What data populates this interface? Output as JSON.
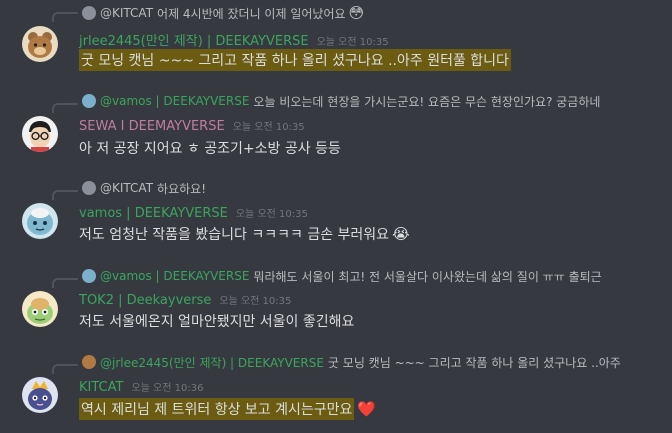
{
  "messages": [
    {
      "reply": {
        "name": "@KITCAT",
        "text": "어제 4시반에 잤더니 이제 일어났어요",
        "emoji": "😳"
      },
      "author": "jrlee2445(만인 제작) | DEEKAYVERSE",
      "author_color": "#3ba55d",
      "time": "오늘 오전 10:35",
      "text": "굿 모닝 캣님 ~~~ 그리고 작품 하나 올리 셨구나요 ..아주 원터풀 합니다",
      "avatar": "bear-avatar"
    },
    {
      "reply": {
        "name": "@vamos | DEEKAYVERSE",
        "text": "오늘 비오는데 현장을 가시는군요! 요즘은 무슨 현장인가요? 궁금하네"
      },
      "author": "SEWA I DEEMAYVERSE",
      "author_color": "#c27c9e",
      "time": "오늘 오전 10:35",
      "text": "아 저 공장 지어요 ㅎ 공조기+소방 공사 등등",
      "avatar": "glasses-avatar"
    },
    {
      "reply": {
        "name": "@KITCAT",
        "text": "하요하요!"
      },
      "author": "vamos | DEEKAYVERSE",
      "author_color": "#3ba55d",
      "time": "오늘 오전 10:35",
      "text": "저도 엄청난 작품을 봤습니다 ㅋㅋㅋㅋ 금손 부러워요",
      "emoji": "😭",
      "avatar": "blue-creature-avatar"
    },
    {
      "reply": {
        "name": "@vamos | DEEKAYVERSE",
        "text": "뭐라해도 서울이 최고! 전 서울살다 이사왔는데 삶의 질이 ㅠㅠ 출퇴근"
      },
      "author": "TOK2 | Deekayverse",
      "author_color": "#3ba55d",
      "time": "오늘 오전 10:35",
      "text": "저도 서울에온지 얼마안됐지만 서울이 좋긴해요",
      "avatar": "turtle-avatar"
    },
    {
      "reply": {
        "name": "@jrlee2445(만인 제작) | DEEKAYVERSE",
        "text": "굿 모닝 캣님 ~~~ 그리고 작품 하나 올리 셨구나요 ..아주"
      },
      "author": "KITCAT",
      "author_color": "#3ba55d",
      "time": "오늘 오전 10:36",
      "text": "역시 제리님 제 트위터 항상 보고 계시는구만요",
      "emoji": "❤️",
      "avatar": "kitcat-avatar"
    }
  ]
}
